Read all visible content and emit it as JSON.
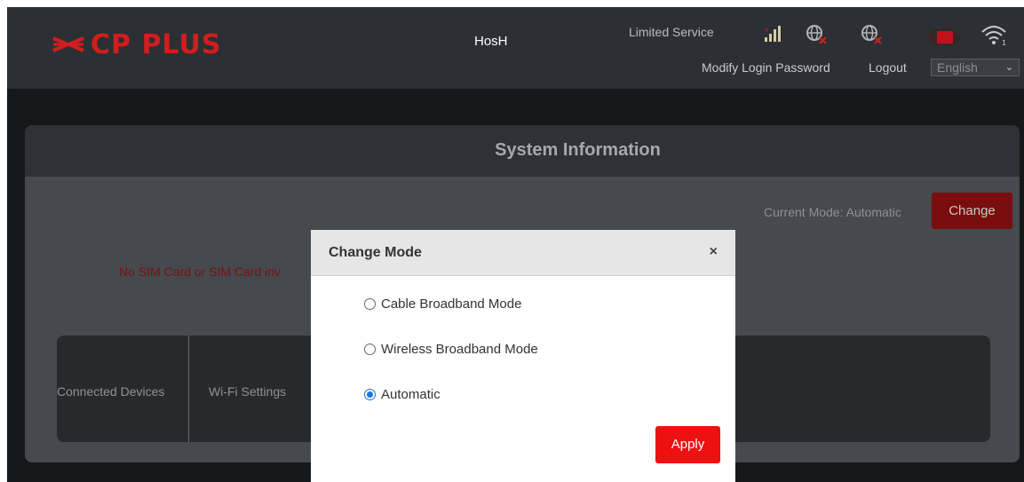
{
  "header": {
    "logo_text": "CP PLUS",
    "hostname": "HosH",
    "status": "Limited Service",
    "modify_password": "Modify Login Password",
    "logout": "Logout",
    "language": "English"
  },
  "system": {
    "title": "System Information",
    "current_mode": "Current Mode: Automatic",
    "change_button": "Change",
    "sim_message": "No SIM Card or SIM Card inv",
    "tiles": [
      "Connected Devices",
      "Wi-Fi Settings"
    ]
  },
  "modal": {
    "title": "Change Mode",
    "close": "×",
    "options": [
      {
        "label": "Cable Broadband Mode",
        "selected": false
      },
      {
        "label": "Wireless Broadband Mode",
        "selected": false
      },
      {
        "label": "Automatic",
        "selected": true
      }
    ],
    "apply": "Apply"
  },
  "colors": {
    "brand_red": "#ee1111",
    "radio_selected": "#1a73e8"
  },
  "icons": [
    "signal-icon",
    "globe-disconnected-icon",
    "globe-disconnected-icon",
    "battery-icon",
    "wifi-icon"
  ]
}
